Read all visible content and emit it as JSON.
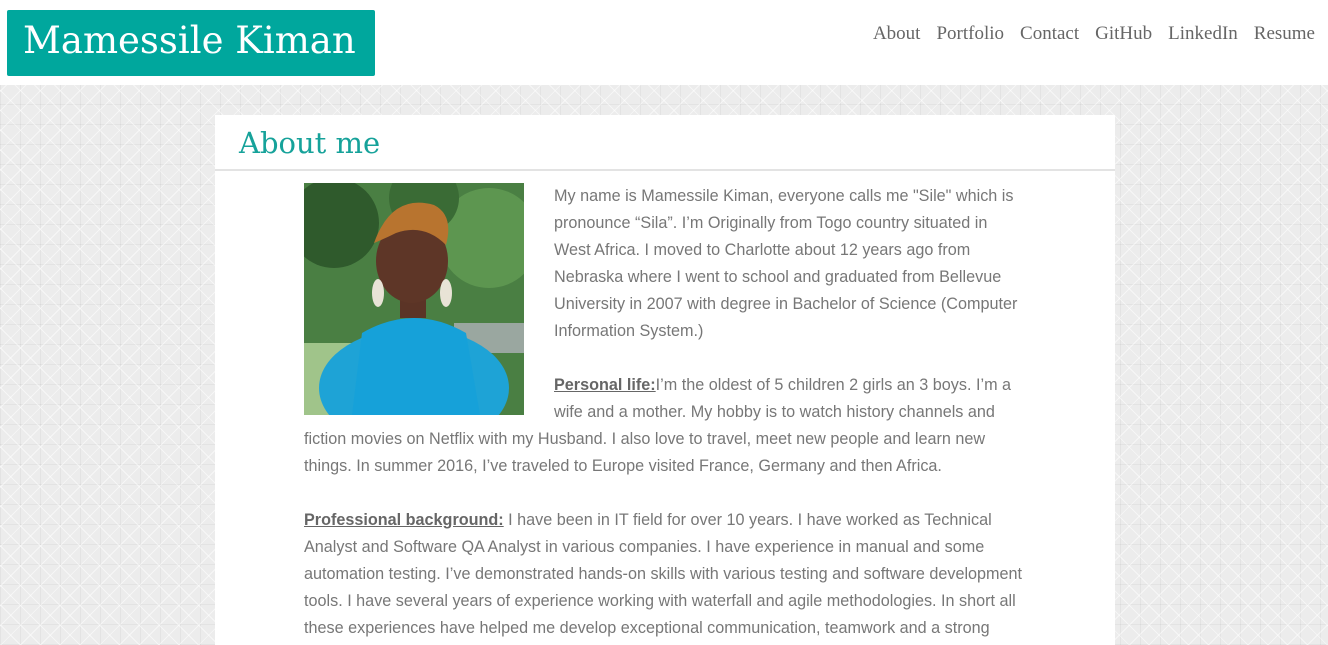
{
  "header": {
    "brand": "Mamessile Kiman",
    "nav": [
      "About",
      "Portfolio",
      "Contact",
      "GitHub",
      "LinkedIn",
      "Resume"
    ]
  },
  "about": {
    "title": "About me",
    "intro": "My name is Mamessile Kiman, everyone calls me \"Sile\" which is pronounce “Sila”. I’m Originally from Togo country situated in West Africa. I moved to Charlotte about 12 years ago from Nebraska where I went to school and graduated from Bellevue University in 2007 with degree in Bachelor of Science (Computer Information System.)",
    "personal_label": "Personal life:",
    "personal_text": "I’m the oldest of 5 children 2 girls an 3 boys. I’m a wife and a mother. My hobby is to watch history channels and fiction movies on Netflix with my Husband. I also love to travel, meet new people and learn new things. In summer 2016, I’ve traveled to Europe visited France, Germany and then Africa.",
    "professional_label": "Professional background:",
    "professional_text": " I have been in IT field for over 10 years. I have worked as Technical Analyst and Software QA Analyst in various companies. I have experience in manual and some automation testing. I’ve demonstrated hands-on skills with various testing and software development tools. I have several years of experience working with waterfall and agile methodologies. In short all these experiences have helped me develop exceptional communication, teamwork and a strong"
  },
  "colors": {
    "brand": "#00a79d",
    "title": "#16a29a",
    "text": "#777777"
  }
}
